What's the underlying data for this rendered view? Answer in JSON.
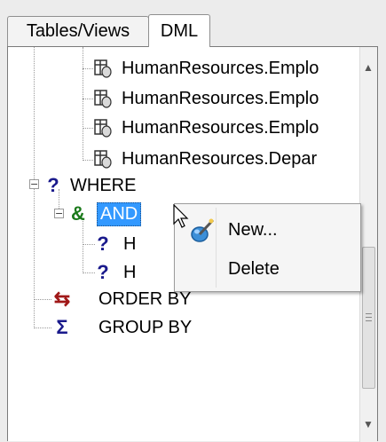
{
  "tabs": [
    {
      "label": "Tables/Views"
    },
    {
      "label": "DML"
    }
  ],
  "tree": {
    "tables": [
      "HumanResources.Emplo",
      "HumanResources.Emplo",
      "HumanResources.Emplo",
      "HumanResources.Depar"
    ],
    "where_label": "WHERE",
    "and_label": "AND",
    "child_labels": [
      "H",
      "H"
    ],
    "order_by_label": "ORDER BY",
    "group_by_label": "GROUP BY"
  },
  "context_menu": {
    "new_label": "New...",
    "delete_label": "Delete"
  },
  "icons": {
    "table": "table-icon",
    "where": "question-icon",
    "and": "ampersand-icon",
    "order_by": "sort-arrows-icon",
    "group_by": "sigma-icon"
  }
}
